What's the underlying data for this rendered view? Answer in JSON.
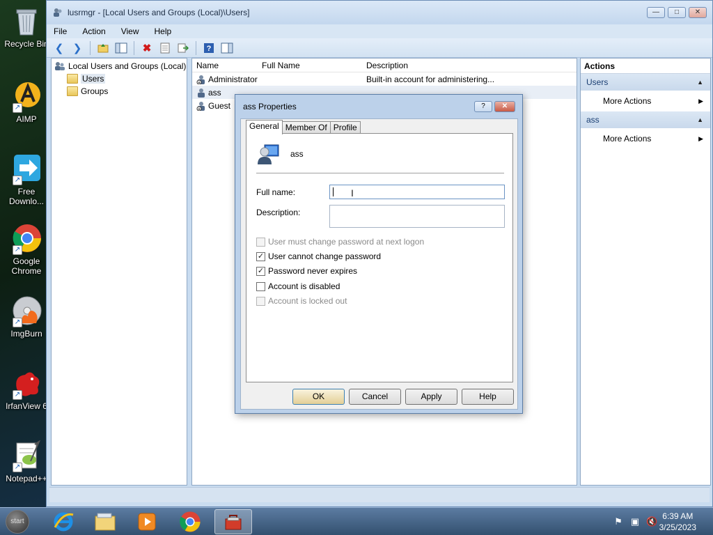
{
  "desktop": {
    "icons": [
      {
        "label": "Recycle Bin",
        "name": "recycle-bin"
      },
      {
        "label": "AIMP",
        "name": "aimp"
      },
      {
        "label": "Free Downlo...",
        "name": "free-download"
      },
      {
        "label": "Google Chrome",
        "name": "google-chrome"
      },
      {
        "label": "ImgBurn",
        "name": "imgburn"
      },
      {
        "label": "IrfanView 6",
        "name": "irfanview"
      },
      {
        "label": "Notepad++",
        "name": "notepad-plus-plus"
      }
    ]
  },
  "window": {
    "title": "lusrmgr - [Local Users and Groups (Local)\\Users]",
    "menu": [
      "File",
      "Action",
      "View",
      "Help"
    ]
  },
  "tree": {
    "root": "Local Users and Groups (Local)",
    "children": [
      "Users",
      "Groups"
    ]
  },
  "list": {
    "headers": [
      "Name",
      "Full Name",
      "Description"
    ],
    "rows": [
      {
        "name": "Administrator",
        "full_name": "",
        "description": "Built-in account for administering..."
      },
      {
        "name": "ass",
        "full_name": "",
        "description": ""
      },
      {
        "name": "Guest",
        "full_name": "",
        "description": ""
      }
    ]
  },
  "actions": {
    "header": "Actions",
    "sections": [
      {
        "title": "Users",
        "item": "More Actions"
      },
      {
        "title": "ass",
        "item": "More Actions"
      }
    ]
  },
  "dialog": {
    "title": "ass Properties",
    "help_btn": "?",
    "close_btn": "✕",
    "tabs": [
      "General",
      "Member Of",
      "Profile"
    ],
    "user_name": "ass",
    "full_name_label": "Full name:",
    "full_name_value": "",
    "description_label": "Description:",
    "description_value": "",
    "checkboxes": [
      {
        "label": "User must change password at next logon",
        "checked": false,
        "disabled": true
      },
      {
        "label": "User cannot change password",
        "checked": true,
        "disabled": false
      },
      {
        "label": "Password never expires",
        "checked": true,
        "disabled": false
      },
      {
        "label": "Account is disabled",
        "checked": false,
        "disabled": false
      },
      {
        "label": "Account is locked out",
        "checked": false,
        "disabled": true
      }
    ],
    "buttons": {
      "ok": "OK",
      "cancel": "Cancel",
      "apply": "Apply",
      "help": "Help"
    }
  },
  "taskbar": {
    "start_label": "start",
    "time": "6:39 AM",
    "date": "3/25/2023"
  }
}
